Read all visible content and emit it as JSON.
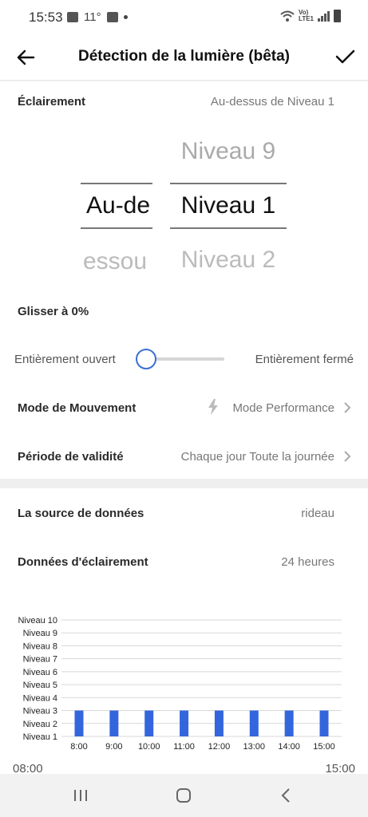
{
  "status_bar": {
    "time": "15:53",
    "temperature": "11°",
    "icons_left": [
      "gallery-icon",
      "mail-icon",
      "dot-icon"
    ],
    "icons_right": [
      "wifi-icon",
      "volte-lte-icon",
      "signal-icon",
      "battery-icon"
    ],
    "lte_label_top": "Vo)",
    "lte_label_bottom": "LTE1"
  },
  "header": {
    "title": "Détection de la lumière (bêta)"
  },
  "lighting": {
    "label": "Éclairement",
    "value": "Au-dessus de Niveau 1",
    "picker_left": {
      "top": "",
      "selected": "Au-de",
      "bottom": "essou"
    },
    "picker_right": {
      "top": "Niveau 9",
      "selected": "Niveau 1",
      "bottom": "Niveau 2"
    }
  },
  "slide": {
    "label": "Glisser à 0%",
    "left_label": "Entièrement ouvert",
    "right_label": "Entièrement fermé",
    "value_percent": 0
  },
  "motion_mode": {
    "label": "Mode de Mouvement",
    "value": "Mode Performance"
  },
  "validity": {
    "label": "Période de validité",
    "value": "Chaque jour Toute la journée"
  },
  "data_source": {
    "label": "La source de données",
    "value": "rideau"
  },
  "lighting_data": {
    "label": "Données d'éclairement",
    "value": "24 heures"
  },
  "chart_data": {
    "type": "bar",
    "categories": [
      "8:00",
      "9:00",
      "10:00",
      "11:00",
      "12:00",
      "13:00",
      "14:00",
      "15:00"
    ],
    "values": [
      3,
      3,
      3,
      3,
      3,
      3,
      3,
      3
    ],
    "y_ticks": [
      "Niveau 1",
      "Niveau 2",
      "Niveau 3",
      "Niveau 4",
      "Niveau 5",
      "Niveau 6",
      "Niveau 7",
      "Niveau 8",
      "Niveau 9",
      "Niveau 10"
    ],
    "ylim": [
      1,
      10
    ],
    "grid": true,
    "bar_color": "#3366dd",
    "title": "",
    "xlabel": "",
    "ylabel": ""
  },
  "time_range": {
    "start": "08:00",
    "end": "15:00"
  },
  "nav_bar": {
    "buttons": [
      "recent-apps-icon",
      "home-icon",
      "back-icon"
    ]
  },
  "colors": {
    "accent": "#3a6fd8",
    "bar": "#3366dd"
  }
}
